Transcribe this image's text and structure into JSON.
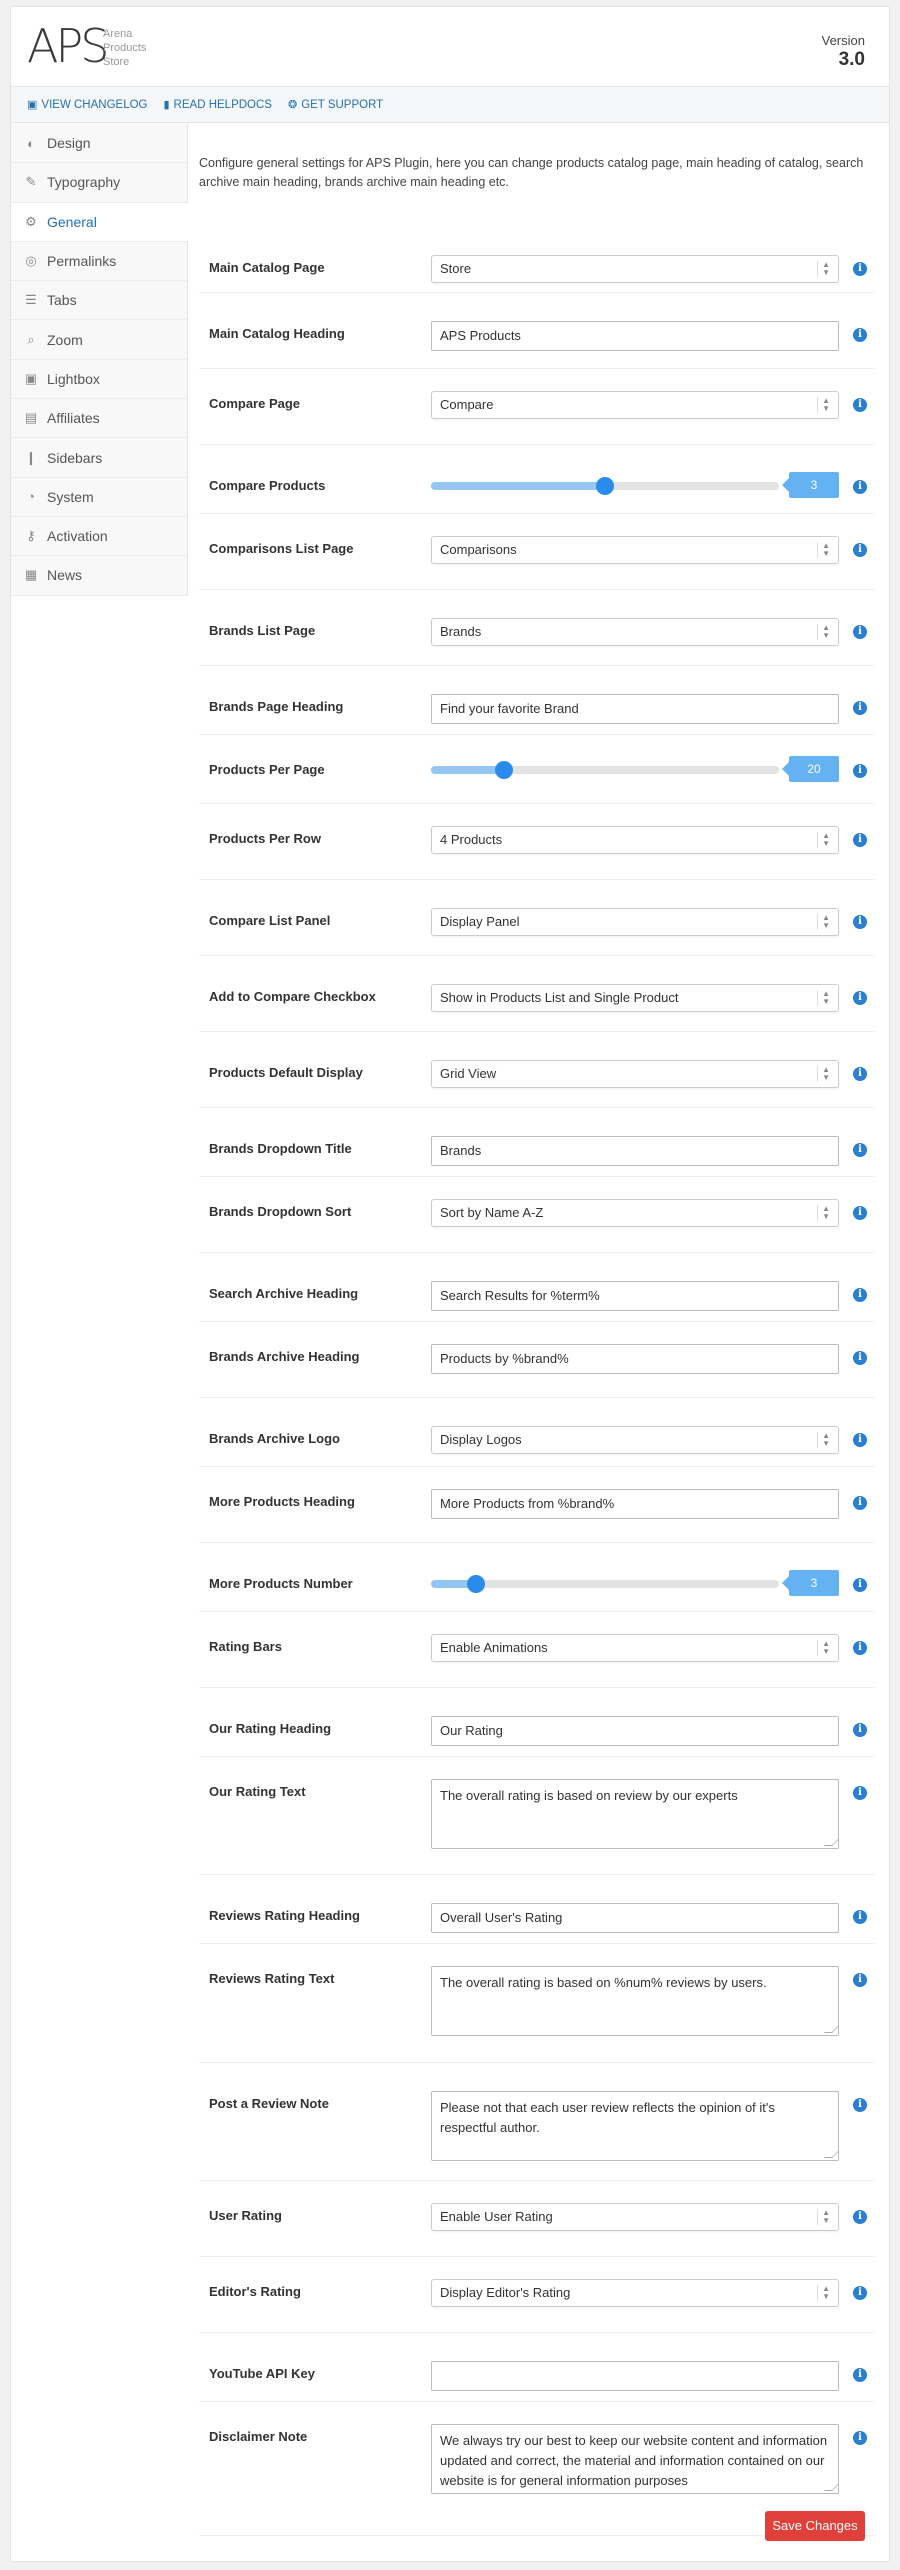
{
  "header": {
    "logo_mark": "APS",
    "logo_line1": "Arena",
    "logo_line2": "Products",
    "logo_line3": "Store",
    "version_label": "Version",
    "version_number": "3.0"
  },
  "links": {
    "changelog": "VIEW CHANGELOG",
    "helpdocs": "READ HELPDOCS",
    "support": "GET SUPPORT"
  },
  "sidebar": {
    "items": [
      {
        "label": "Design",
        "icon": "palette-icon"
      },
      {
        "label": "Typography",
        "icon": "pen-icon"
      },
      {
        "label": "General",
        "icon": "gears-icon"
      },
      {
        "label": "Permalinks",
        "icon": "globe-icon"
      },
      {
        "label": "Tabs",
        "icon": "list-icon"
      },
      {
        "label": "Zoom",
        "icon": "magnifier-icon"
      },
      {
        "label": "Lightbox",
        "icon": "image-icon"
      },
      {
        "label": "Affiliates",
        "icon": "money-icon"
      },
      {
        "label": "Sidebars",
        "icon": "columns-icon"
      },
      {
        "label": "System",
        "icon": "dashboard-icon"
      },
      {
        "label": "Activation",
        "icon": "key-icon"
      },
      {
        "label": "News",
        "icon": "newspaper-icon"
      }
    ],
    "active": "General"
  },
  "intro": "Configure general settings for APS Plugin, here you can change products catalog page, main heading of catalog, search archive main heading, brands archive main heading etc.",
  "fields": {
    "main_catalog_page": {
      "label": "Main Catalog Page",
      "value": "Store"
    },
    "main_catalog_heading": {
      "label": "Main Catalog Heading",
      "value": "APS Products"
    },
    "compare_page": {
      "label": "Compare Page",
      "value": "Compare"
    },
    "compare_products": {
      "label": "Compare Products",
      "value": "3",
      "fraction": 0.5
    },
    "comparisons_list_page": {
      "label": "Comparisons List Page",
      "value": "Comparisons"
    },
    "brands_list_page": {
      "label": "Brands List Page",
      "value": "Brands"
    },
    "brands_page_heading": {
      "label": "Brands Page Heading",
      "value": "Find your favorite Brand"
    },
    "products_per_page": {
      "label": "Products Per Page",
      "value": "20",
      "fraction": 0.21
    },
    "products_per_row": {
      "label": "Products Per Row",
      "value": "4 Products"
    },
    "compare_list_panel": {
      "label": "Compare List Panel",
      "value": "Display Panel"
    },
    "add_to_compare": {
      "label": "Add to Compare Checkbox",
      "value": "Show in Products List and Single Product"
    },
    "products_default_display": {
      "label": "Products Default Display",
      "value": "Grid View"
    },
    "brands_dropdown_title": {
      "label": "Brands Dropdown Title",
      "value": "Brands"
    },
    "brands_dropdown_sort": {
      "label": "Brands Dropdown Sort",
      "value": "Sort by Name A-Z"
    },
    "search_archive_heading": {
      "label": "Search Archive Heading",
      "value": "Search Results for %term%"
    },
    "brands_archive_heading": {
      "label": "Brands Archive Heading",
      "value": "Products by %brand%"
    },
    "brands_archive_logo": {
      "label": "Brands Archive Logo",
      "value": "Display Logos"
    },
    "more_products_heading": {
      "label": "More Products Heading",
      "value": "More Products from %brand%"
    },
    "more_products_number": {
      "label": "More Products Number",
      "value": "3",
      "fraction": 0.13
    },
    "rating_bars": {
      "label": "Rating Bars",
      "value": "Enable Animations"
    },
    "our_rating_heading": {
      "label": "Our Rating Heading",
      "value": "Our Rating"
    },
    "our_rating_text": {
      "label": "Our Rating Text",
      "value": "The overall rating is based on review by our experts"
    },
    "reviews_rating_heading": {
      "label": "Reviews Rating Heading",
      "value": "Overall User's Rating"
    },
    "reviews_rating_text": {
      "label": "Reviews Rating Text",
      "value": "The overall rating is based on %num% reviews by users."
    },
    "post_review_note": {
      "label": "Post a Review Note",
      "value": "Please not that each user review reflects the opinion of it's respectful author."
    },
    "user_rating": {
      "label": "User Rating",
      "value": "Enable User Rating"
    },
    "editors_rating": {
      "label": "Editor's Rating",
      "value": "Display Editor's Rating"
    },
    "youtube_api_key": {
      "label": "YouTube API Key",
      "value": ""
    },
    "disclaimer_note": {
      "label": "Disclaimer Note",
      "value": "We always try our best to keep our website content and information updated and correct, the material and information contained on our website is for general information purposes"
    }
  },
  "info_glyph": "i",
  "save_label": "Save Changes",
  "colors": {
    "accent": "#2271b1",
    "save": "#e0403a",
    "slider": "#2a8cea"
  }
}
